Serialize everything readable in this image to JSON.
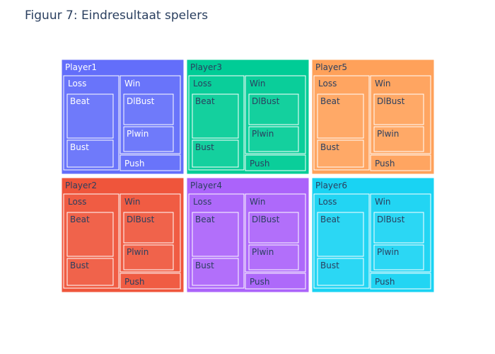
{
  "chart_data": {
    "type": "treemap",
    "title": "Figuur 7: Eindresultaat spelers",
    "players": [
      {
        "name": "Player1",
        "color": "#636efa",
        "text_color": "#ffffff",
        "children": [
          {
            "name": "Loss",
            "children": [
              {
                "name": "Beat"
              },
              {
                "name": "Bust"
              }
            ]
          },
          {
            "name": "Win",
            "children": [
              {
                "name": "DlBust"
              },
              {
                "name": "Plwin"
              }
            ]
          },
          {
            "name": "Push"
          }
        ]
      },
      {
        "name": "Player2",
        "color": "#ef553b",
        "text_color": "#2a3f5f",
        "children": [
          {
            "name": "Loss",
            "children": [
              {
                "name": "Beat"
              },
              {
                "name": "Bust"
              }
            ]
          },
          {
            "name": "Win",
            "children": [
              {
                "name": "DlBust"
              },
              {
                "name": "Plwin"
              }
            ]
          },
          {
            "name": "Push"
          }
        ]
      },
      {
        "name": "Player3",
        "color": "#00cc96",
        "text_color": "#2a3f5f",
        "children": [
          {
            "name": "Loss",
            "children": [
              {
                "name": "Beat"
              },
              {
                "name": "Bust"
              }
            ]
          },
          {
            "name": "Win",
            "children": [
              {
                "name": "DlBust"
              },
              {
                "name": "Plwin"
              }
            ]
          },
          {
            "name": "Push"
          }
        ]
      },
      {
        "name": "Player4",
        "color": "#ab63fa",
        "text_color": "#2a3f5f",
        "children": [
          {
            "name": "Loss",
            "children": [
              {
                "name": "Beat"
              },
              {
                "name": "Bust"
              }
            ]
          },
          {
            "name": "Win",
            "children": [
              {
                "name": "DlBust"
              },
              {
                "name": "Plwin"
              }
            ]
          },
          {
            "name": "Push"
          }
        ]
      },
      {
        "name": "Player5",
        "color": "#ffa15a",
        "text_color": "#2a3f5f",
        "children": [
          {
            "name": "Loss",
            "children": [
              {
                "name": "Beat"
              },
              {
                "name": "Bust"
              }
            ]
          },
          {
            "name": "Win",
            "children": [
              {
                "name": "DlBust"
              },
              {
                "name": "Plwin"
              }
            ]
          },
          {
            "name": "Push"
          }
        ]
      },
      {
        "name": "Player6",
        "color": "#19d3f3",
        "text_color": "#2a3f5f",
        "children": [
          {
            "name": "Loss",
            "children": [
              {
                "name": "Beat"
              },
              {
                "name": "Bust"
              }
            ]
          },
          {
            "name": "Win",
            "children": [
              {
                "name": "DlBust"
              },
              {
                "name": "Plwin"
              }
            ]
          },
          {
            "name": "Push"
          }
        ]
      }
    ]
  }
}
